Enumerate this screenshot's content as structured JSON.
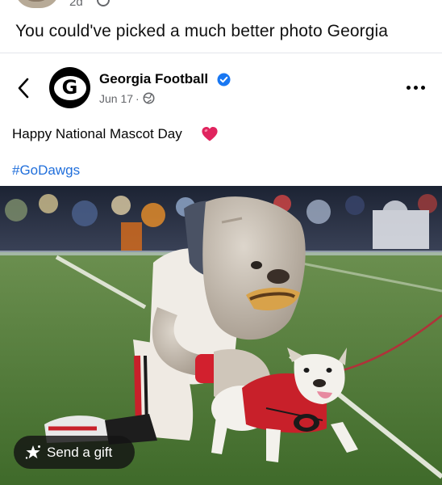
{
  "previous_comment": {
    "time": "2d",
    "text": "You could've picked a much better photo Georgia"
  },
  "post": {
    "page_name": "Georgia Football",
    "date": "Jun 17",
    "separator": "·",
    "avatar_letter": "G",
    "text": "Happy National Mascot Day",
    "hashtag": "#GoDawgs"
  },
  "gift_button": {
    "label": "Send a gift"
  },
  "colors": {
    "link_blue": "#216fdb",
    "verified_blue": "#1877f2",
    "secondary_text": "#65676b",
    "heart_red": "#e0245e",
    "gift_bg": "#141414"
  },
  "icons": {
    "back": "chevron-left-icon",
    "verified": "verified-badge-icon",
    "audience": "globe-icon",
    "more": "more-horizontal-icon",
    "reaction": "red-heart-emoji-icon",
    "gift": "gift-star-icon"
  }
}
